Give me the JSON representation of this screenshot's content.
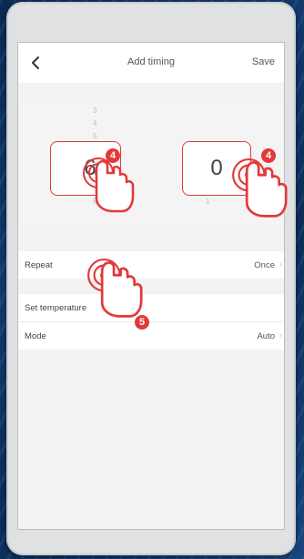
{
  "header": {
    "title": "Add timing",
    "save_label": "Save"
  },
  "picker": {
    "hour": {
      "value": "6",
      "above": [
        "3",
        "4",
        "5"
      ],
      "below": [
        "8"
      ]
    },
    "minute": {
      "value": "0",
      "below": [
        "1"
      ]
    }
  },
  "rows": [
    {
      "label": "Repeat",
      "value": "Once"
    },
    {
      "label": "Set temperature",
      "value": ""
    },
    {
      "label": "Mode",
      "value": "Auto"
    }
  ],
  "annotations": {
    "step_hour": "4",
    "step_minute": "4",
    "step_repeat": "5"
  },
  "colors": {
    "accent": "#e2393a",
    "screen_bg": "#f3f3f3",
    "frame": "#dfe1e3"
  },
  "icons": [
    "chevron-left-icon",
    "chevron-right-icon",
    "tap-hand-icon"
  ]
}
